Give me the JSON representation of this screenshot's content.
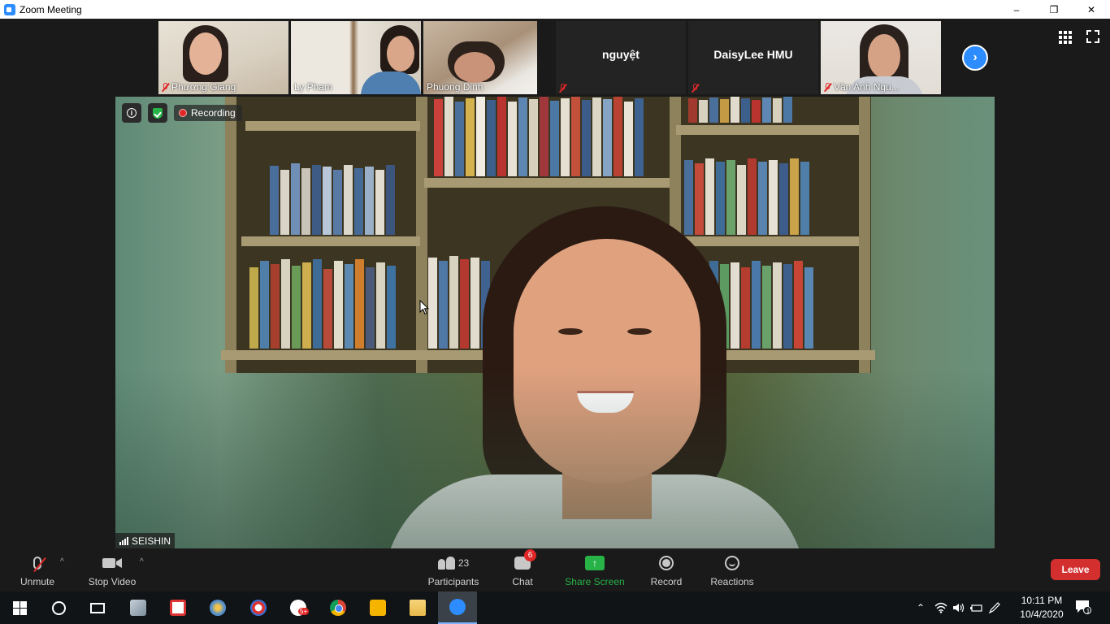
{
  "window": {
    "title": "Zoom Meeting",
    "controls": [
      "–",
      "❐",
      "✕"
    ]
  },
  "gallery": [
    {
      "name": "Phương Giang",
      "muted": true,
      "has_video": true
    },
    {
      "name": "Ly Pham",
      "muted": false,
      "has_video": true
    },
    {
      "name": "Phuong Dinh",
      "muted": false,
      "has_video": true
    },
    {
      "name": "nguyệt",
      "muted": true,
      "has_video": false
    },
    {
      "name": "DaisyLee HMU",
      "muted": true,
      "has_video": false
    },
    {
      "name": "Vân Anh Ngu...",
      "muted": true,
      "has_video": true
    }
  ],
  "video": {
    "recording_label": "Recording",
    "speaker_name": "SEISHIN",
    "info_glyph": "i"
  },
  "toolbar": {
    "unmute": "Unmute",
    "stop_video": "Stop Video",
    "participants": "Participants",
    "participants_count": "23",
    "chat": "Chat",
    "chat_badge": "6",
    "share_screen": "Share Screen",
    "record": "Record",
    "reactions": "Reactions",
    "leave": "Leave",
    "caret": "^"
  },
  "taskbar": {
    "time": "10:11 PM",
    "date": "10/4/2020",
    "notification_count": "1",
    "teams_badge": "5+"
  },
  "colors": {
    "accent_blue": "#2d8cff",
    "leave_red": "#d32f2f",
    "share_green": "#27b348",
    "muted_red": "#e02828"
  }
}
